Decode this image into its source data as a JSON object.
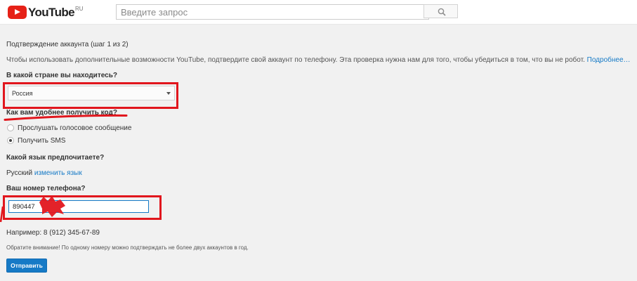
{
  "header": {
    "logo_text": "YouTube",
    "logo_region": "RU",
    "search_placeholder": "Введите запрос",
    "search_icon": "search-icon"
  },
  "form": {
    "title": "Подтверждение аккаунта (шаг 1 из 2)",
    "description": "Чтобы использовать дополнительные возможности YouTube, подтвердите свой аккаунт по телефону. Эта проверка нужна нам для того, чтобы убедиться в том, что вы не робот.",
    "more_link": "Подробнее…",
    "country_question": "В какой стране вы находитесь?",
    "country_value": "Россия",
    "code_question": "Как вам удобнее получить код?",
    "code_options": [
      {
        "label": "Прослушать голосовое сообщение",
        "selected": false
      },
      {
        "label": "Получить SMS",
        "selected": true
      }
    ],
    "language_question": "Какой язык предпочитаете?",
    "language_value": "Русский",
    "change_language_link": "изменить язык",
    "phone_question": "Ваш номер телефона?",
    "phone_value": "890447",
    "phone_example": "Например: 8 (912) 345-67-89",
    "notice": "Обратите внимание! По одному номеру можно подтверждать не более двух аккаунтов в год.",
    "submit_label": "Отправить"
  },
  "colors": {
    "accent_blue": "#167ac6",
    "annotation_red": "#e1161d",
    "brand_red": "#e62117"
  }
}
